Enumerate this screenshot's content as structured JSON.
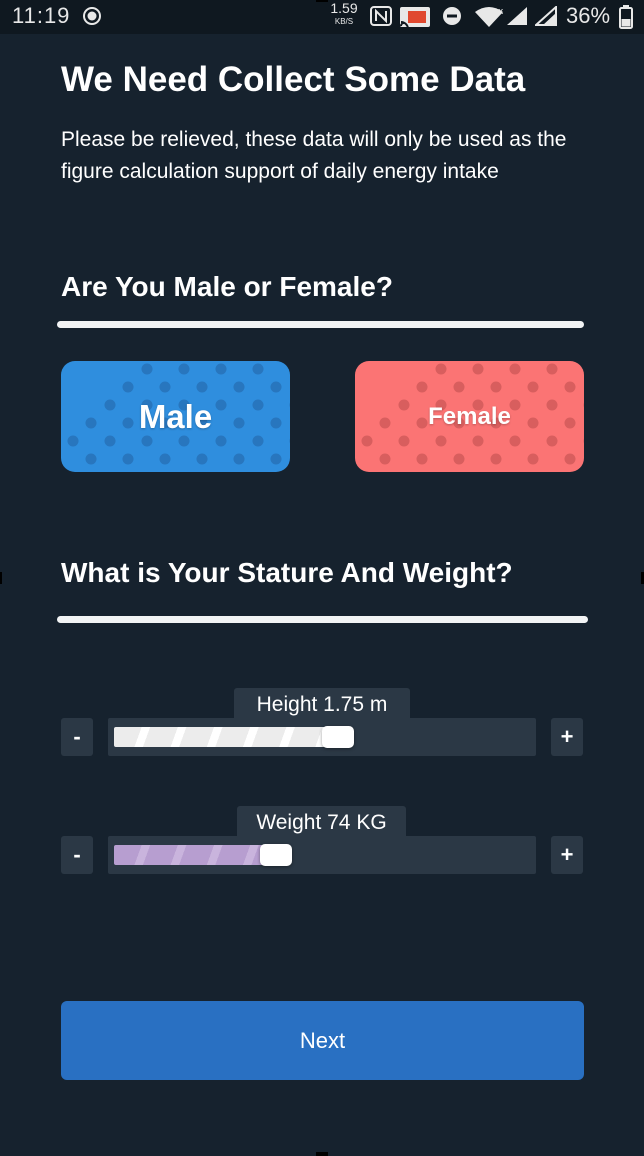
{
  "status_bar": {
    "time": "11:19",
    "net_speed": "1.59",
    "net_speed_unit": "KB/S",
    "battery_percent": "36%",
    "icons": [
      "record-icon",
      "nfc-icon",
      "cast-icon",
      "do-not-disturb-icon",
      "wifi-icon",
      "signal-icon",
      "signal-icon",
      "battery-icon"
    ]
  },
  "header": {
    "title": "We Need Collect Some Data",
    "subtitle": "Please be relieved, these data will only be used as the figure calculation support of daily energy intake"
  },
  "gender_section": {
    "heading": "Are You Male or Female?",
    "options": [
      {
        "label": "Male",
        "color": "#2f8ede"
      },
      {
        "label": "Female",
        "color": "#fb7474"
      }
    ]
  },
  "body_section": {
    "heading": "What is Your Stature And Weight?",
    "height_slider": {
      "label": "Height 1.75 m",
      "value": 1.75,
      "unit": "m",
      "fill_fraction": 0.5,
      "decrement_label": "-",
      "increment_label": "+"
    },
    "weight_slider": {
      "label": "Weight 74 KG",
      "value": 74,
      "unit": "KG",
      "fill_fraction": 0.35,
      "decrement_label": "-",
      "increment_label": "+"
    }
  },
  "footer": {
    "next_label": "Next",
    "next_color": "#2970c2"
  }
}
